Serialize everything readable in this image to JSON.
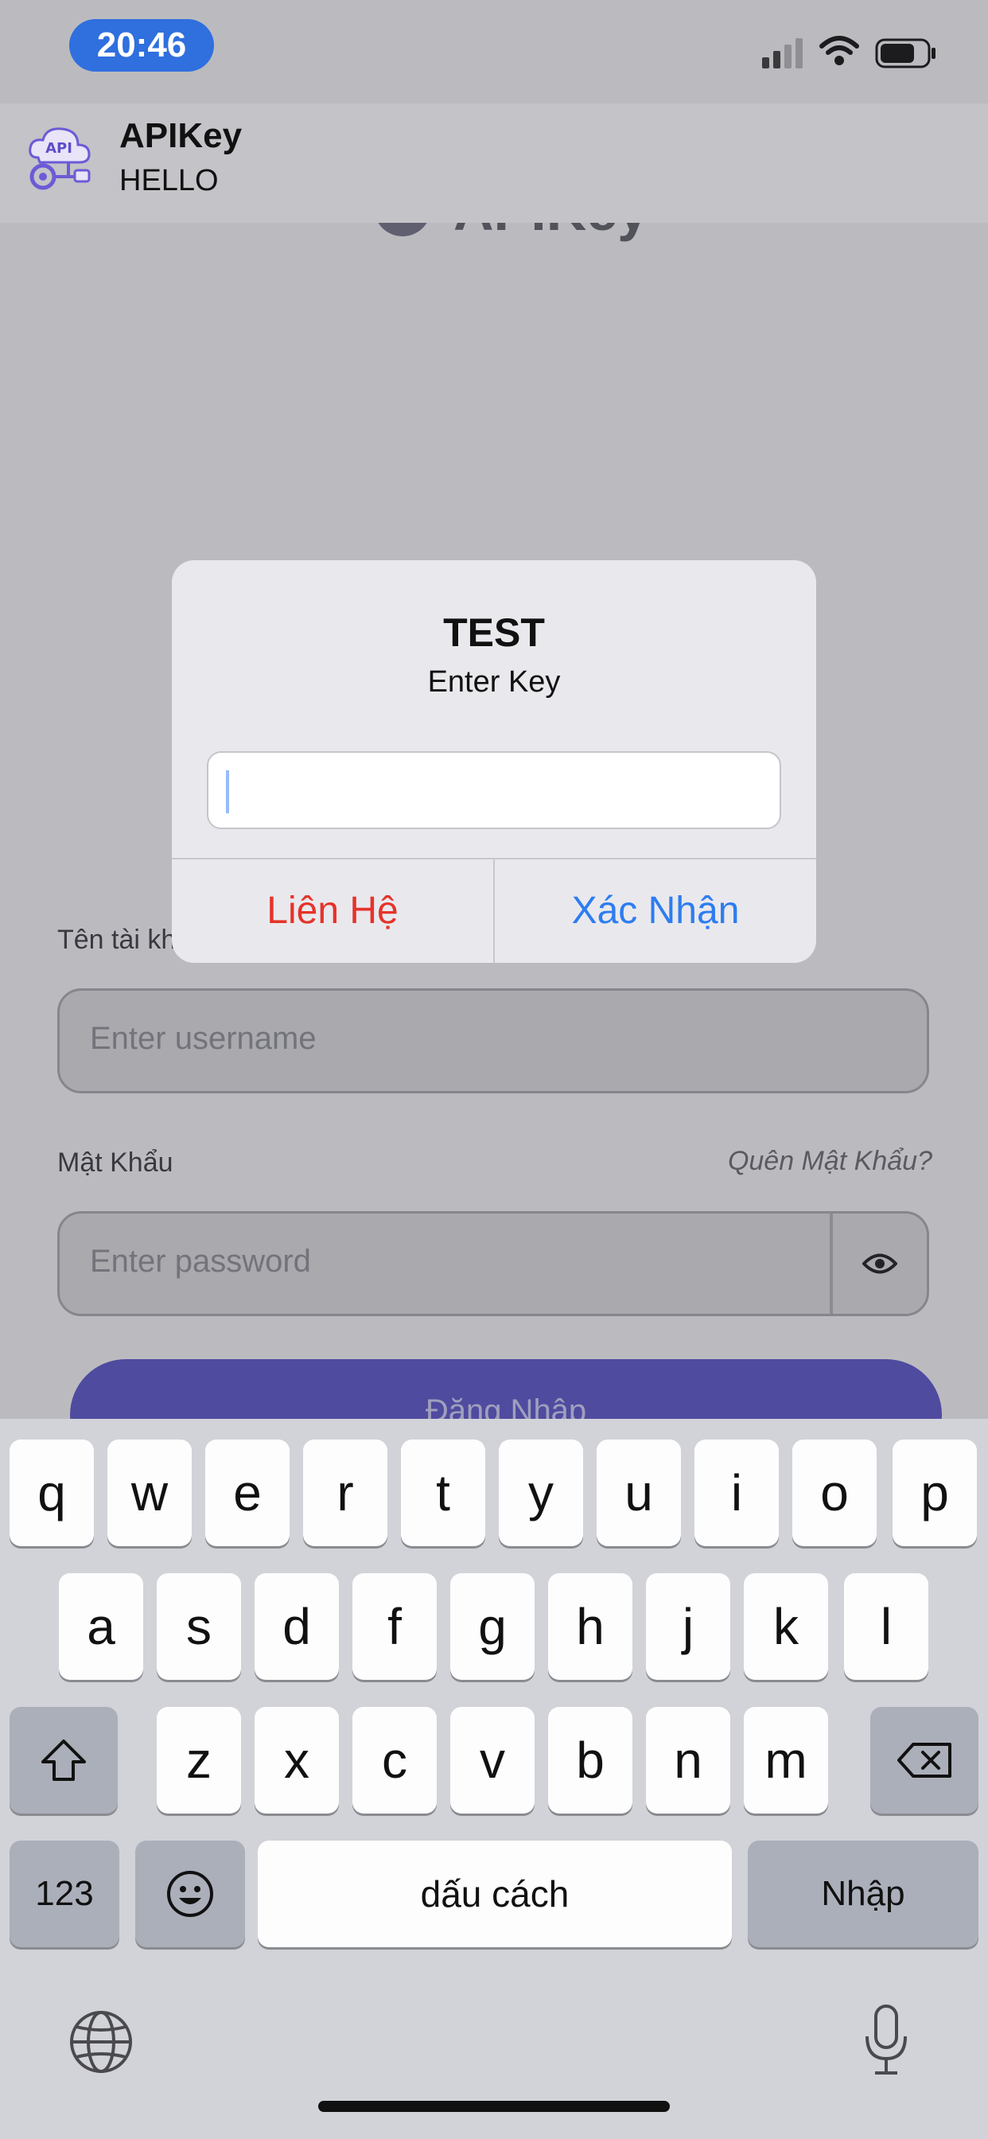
{
  "status_bar": {
    "time": "20:46"
  },
  "banner": {
    "app_name": "APIKey",
    "message": "HELLO",
    "icon_text": "API"
  },
  "app": {
    "title_partial": "APIKey",
    "username_label": "Tên tài kh",
    "username_placeholder": "Enter username",
    "password_label": "Mật Khẩu",
    "forgot_password": "Quên Mật Khẩu?",
    "password_placeholder": "Enter password",
    "login_button": "Đăng Nhập"
  },
  "alert": {
    "title": "TEST",
    "message": "Enter Key",
    "input_value": "",
    "left_button": "Liên Hệ",
    "right_button": "Xác Nhận"
  },
  "keyboard": {
    "row1": [
      "q",
      "w",
      "e",
      "r",
      "t",
      "y",
      "u",
      "i",
      "o",
      "p"
    ],
    "row2": [
      "a",
      "s",
      "d",
      "f",
      "g",
      "h",
      "j",
      "k",
      "l"
    ],
    "row3": [
      "z",
      "x",
      "c",
      "v",
      "b",
      "n",
      "m"
    ],
    "numbers_key": "123",
    "space_key": "dấu cách",
    "return_key": "Nhập"
  },
  "colors": {
    "accent": "#2f6fde",
    "destructive": "#e5332a",
    "primary_button": "#5b55c9"
  }
}
